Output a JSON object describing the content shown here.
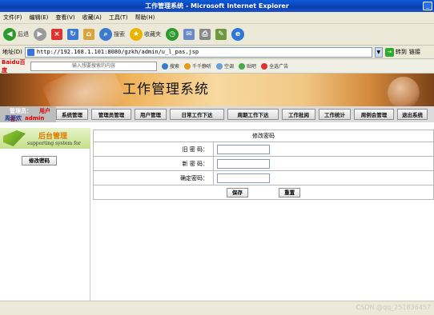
{
  "window": {
    "title": "工作管理系统 - Microsoft Internet Explorer"
  },
  "menu": [
    "文件(F)",
    "编辑(E)",
    "查看(V)",
    "收藏(A)",
    "工具(T)",
    "帮助(H)"
  ],
  "toolbar": {
    "back": "后退",
    "search": "搜索",
    "favorites": "收藏夹"
  },
  "address": {
    "label": "地址(D)",
    "url": "http://192.168.1.101:8080/gzkh/admin/u_l_pas.jsp",
    "go": "转到",
    "links": "链接"
  },
  "searchbar": {
    "logo": "Baidu百度",
    "placeholder": "输入想要搜索的内容",
    "items": [
      "搜索",
      "千千静听",
      "空调",
      "贴吧",
      "全选广告"
    ]
  },
  "page": {
    "system_title": "工作管理系统",
    "user": {
      "role_label": "管理员：",
      "name_label": "用户名：",
      "role_value": "周涯欢",
      "name_value": "admin"
    },
    "nav": [
      "系统管理",
      "管理员管理",
      "用户管理",
      "日常工作下达",
      "周期工作下达",
      "工作批阅",
      "工作统计",
      "周例会管理",
      "退出系统"
    ],
    "sidebar": {
      "title": "后台管理",
      "subtitle": "supporting system for",
      "button": "修改密码"
    },
    "form": {
      "heading": "修改密码",
      "old_label": "旧 密 码：",
      "new_label": "新 密 码：",
      "confirm_label": "确定密码：",
      "old_value": "",
      "new_value": "",
      "confirm_value": "",
      "save": "保存",
      "reset": "重置"
    }
  },
  "watermark": "CSDN @qq_251836457"
}
